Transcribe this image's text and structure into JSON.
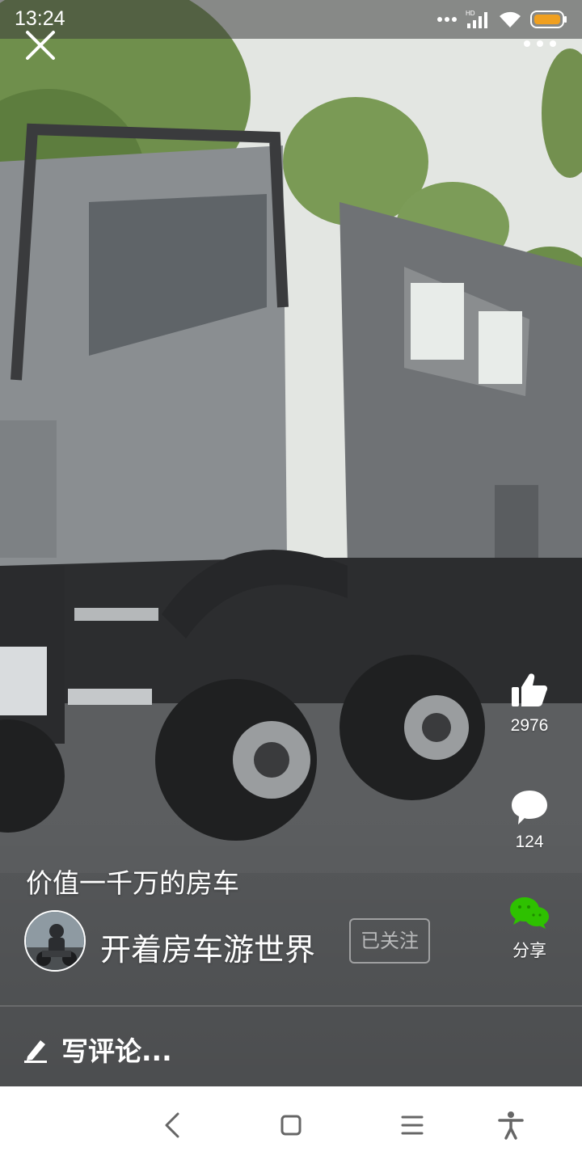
{
  "status_bar": {
    "time": "13:24",
    "icons": [
      "more-dots-icon",
      "hd-signal-icon",
      "wifi-icon",
      "battery-icon"
    ],
    "battery_color": "#f0a020"
  },
  "top_controls": {
    "close_icon": "close-icon",
    "more_icon": "more-horizontal-icon"
  },
  "actions": {
    "like": {
      "icon": "thumbs-up-icon",
      "count": "2976"
    },
    "comment": {
      "icon": "comment-bubble-icon",
      "count": "124"
    },
    "share": {
      "icon": "wechat-icon",
      "label": "分享",
      "color": "#2ec100"
    }
  },
  "video": {
    "title": "价值一千万的房车"
  },
  "author": {
    "name": "开着房车游世界",
    "follow_label": "已关注"
  },
  "comment_bar": {
    "placeholder": "写评论...",
    "icon": "pencil-icon"
  },
  "nav_bar": {
    "buttons": [
      "back-icon",
      "home-icon",
      "menu-icon",
      "accessibility-icon"
    ]
  }
}
